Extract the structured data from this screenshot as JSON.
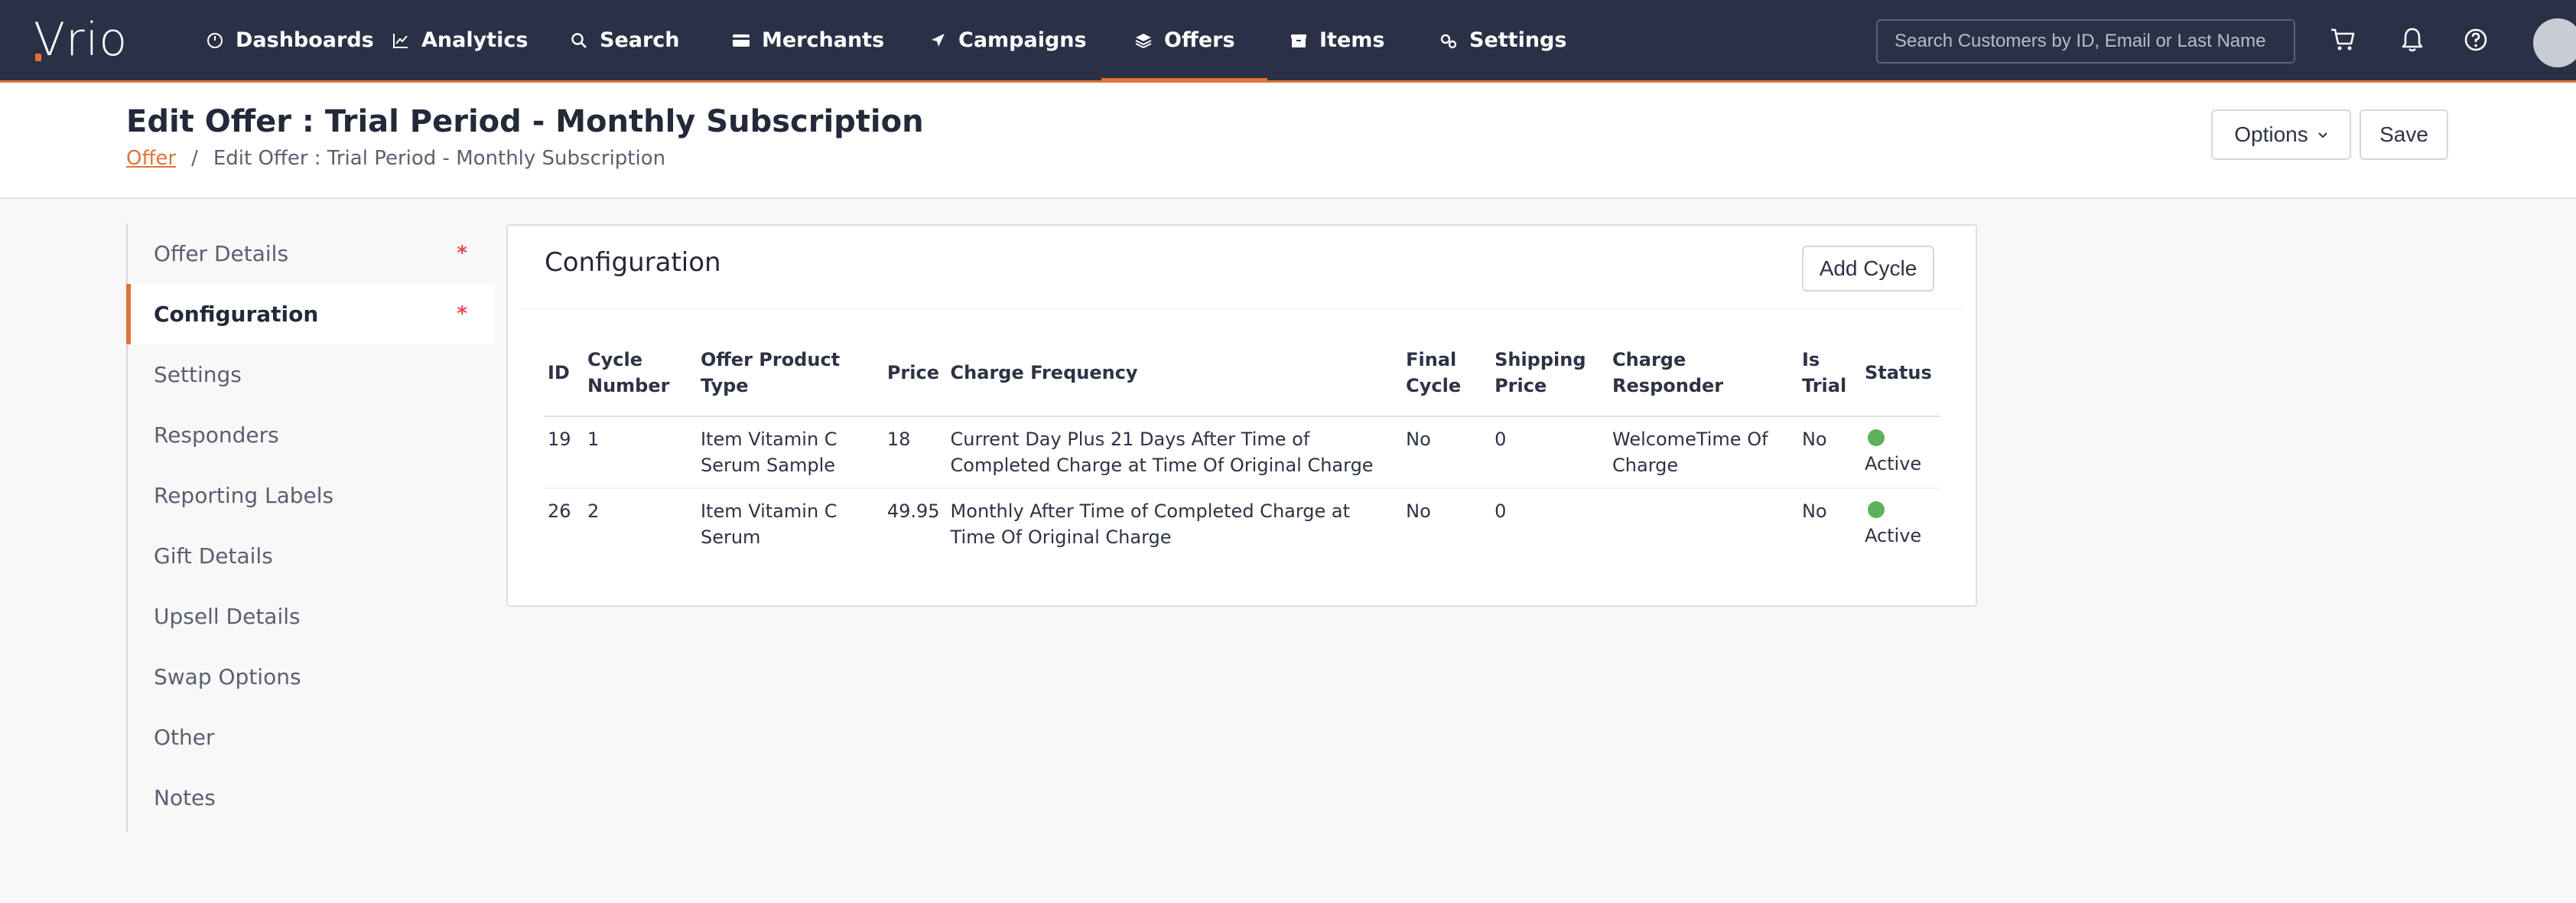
{
  "app": {
    "logo": "Vrio"
  },
  "nav": {
    "items": [
      {
        "label": "Dashboards",
        "icon": "gauge-icon"
      },
      {
        "label": "Analytics",
        "icon": "line-chart-icon"
      },
      {
        "label": "Search",
        "icon": "search-icon"
      },
      {
        "label": "Merchants",
        "icon": "credit-card-icon"
      },
      {
        "label": "Campaigns",
        "icon": "paper-plane-icon"
      },
      {
        "label": "Offers",
        "icon": "layers-icon"
      },
      {
        "label": "Items",
        "icon": "box-icon"
      },
      {
        "label": "Settings",
        "icon": "gears-icon"
      }
    ],
    "active": "Offers",
    "search_placeholder": "Search Customers by ID, Email or Last Name"
  },
  "header": {
    "title": "Edit Offer : Trial Period - Monthly Subscription",
    "breadcrumb_link": "Offer",
    "breadcrumb_current": "Edit Offer : Trial Period - Monthly Subscription",
    "options_label": "Options",
    "save_label": "Save"
  },
  "sidebar": {
    "items": [
      {
        "label": "Offer Details",
        "required": "*"
      },
      {
        "label": "Configuration",
        "required": "*"
      },
      {
        "label": "Settings",
        "required": ""
      },
      {
        "label": "Responders",
        "required": ""
      },
      {
        "label": "Reporting Labels",
        "required": ""
      },
      {
        "label": "Gift Details",
        "required": ""
      },
      {
        "label": "Upsell Details",
        "required": ""
      },
      {
        "label": "Swap Options",
        "required": ""
      },
      {
        "label": "Other",
        "required": ""
      },
      {
        "label": "Notes",
        "required": ""
      }
    ],
    "active": "Configuration"
  },
  "config": {
    "title": "Configuration",
    "add_cycle_label": "Add Cycle",
    "columns": [
      "ID",
      "Cycle Number",
      "Offer Product Type",
      "Price",
      "Charge Frequency",
      "Final Cycle",
      "Shipping Price",
      "Charge Responder",
      "Is Trial",
      "Status"
    ],
    "rows": [
      {
        "id": "19",
        "cycle": "1",
        "product": "Item Vitamin C Serum Sample",
        "price": "18",
        "frequency": "Current Day Plus 21 Days After Time of Completed Charge at Time Of Original Charge",
        "final": "No",
        "shipping": "0",
        "responder": "WelcomeTime Of Charge",
        "trial": "No",
        "status": "Active"
      },
      {
        "id": "26",
        "cycle": "2",
        "product": "Item Vitamin C Serum",
        "price": "49.95",
        "frequency": "Monthly After Time of Completed Charge at Time Of Original Charge",
        "final": "No",
        "shipping": "0",
        "responder": "",
        "trial": "No",
        "status": "Active"
      }
    ]
  },
  "colors": {
    "nav_bg": "#2a3146",
    "accent": "#e0733a",
    "active_status": "#5bb25a",
    "required": "#e84a4a"
  }
}
